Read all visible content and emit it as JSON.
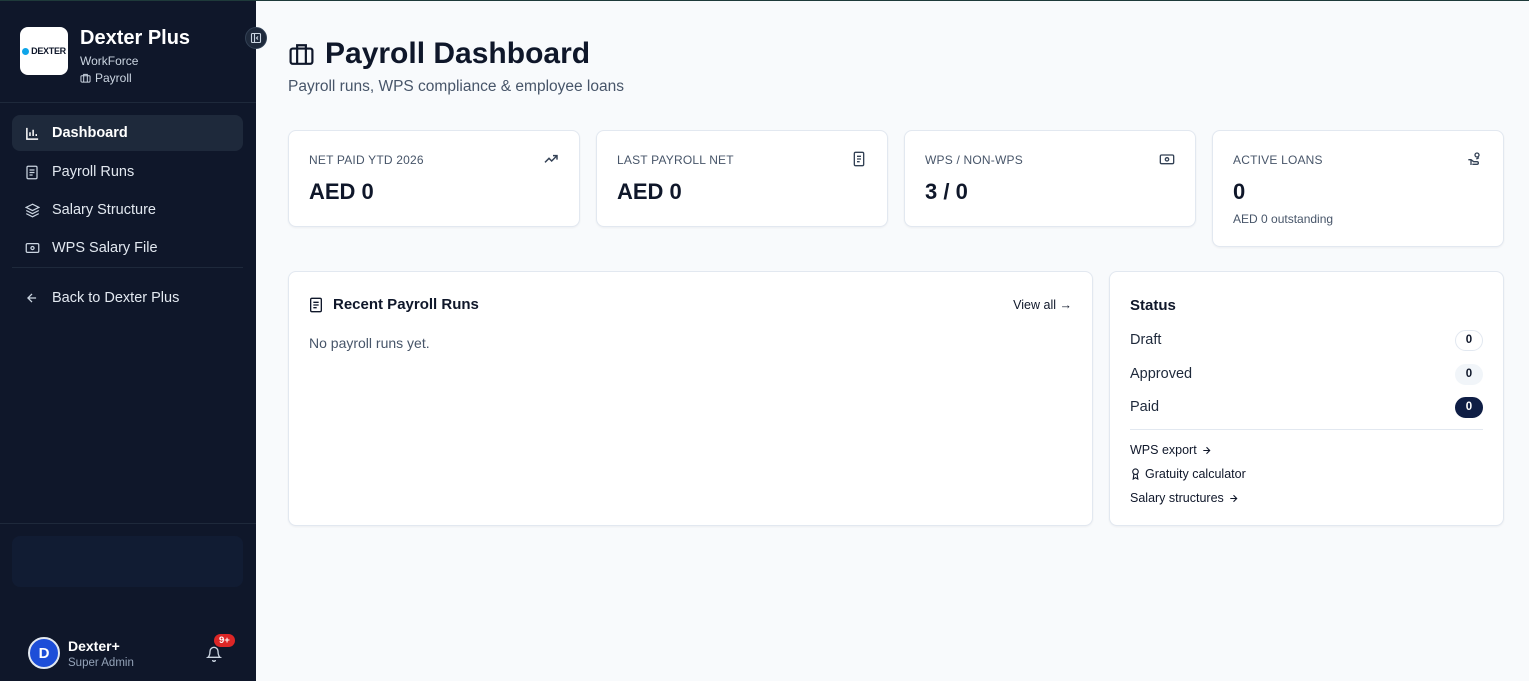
{
  "sidebar": {
    "brand_title": "Dexter Plus",
    "brand_sub": "WorkForce",
    "brand_module": "Payroll",
    "logo_text": "DEXTER",
    "nav": [
      {
        "label": "Dashboard",
        "icon": "bar-chart-icon",
        "active": true
      },
      {
        "label": "Payroll Runs",
        "icon": "document-icon"
      },
      {
        "label": "Salary Structure",
        "icon": "layers-icon"
      },
      {
        "label": "WPS Salary File",
        "icon": "banknote-icon"
      }
    ],
    "back_label": "Back to Dexter Plus",
    "user": {
      "initial": "D",
      "name": "Dexter+",
      "role": "Super Admin"
    },
    "notifications_badge": "9+"
  },
  "page": {
    "title": "Payroll Dashboard",
    "subtitle": "Payroll runs, WPS compliance & employee loans"
  },
  "kpis": [
    {
      "label": "NET PAID YTD 2026",
      "value": "AED 0",
      "icon": "trending-up-icon"
    },
    {
      "label": "LAST PAYROLL NET",
      "value": "AED 0",
      "icon": "document-icon"
    },
    {
      "label": "WPS / NON-WPS",
      "value": "3 / 0",
      "icon": "banknote-icon"
    },
    {
      "label": "ACTIVE LOANS",
      "value": "0",
      "note": "AED 0 outstanding",
      "icon": "hand-coins-icon"
    }
  ],
  "recent": {
    "title": "Recent Payroll Runs",
    "view_all": "View all →",
    "empty": "No payroll runs yet."
  },
  "status": {
    "title": "Status",
    "rows": [
      {
        "label": "Draft",
        "count": "0"
      },
      {
        "label": "Approved",
        "count": "0"
      },
      {
        "label": "Paid",
        "count": "0"
      }
    ],
    "links": {
      "wps_export": "WPS export",
      "gratuity": "Gratuity calculator",
      "salary_structures": "Salary structures"
    }
  },
  "colors": {
    "sidebar_bg": "#0f172a",
    "page_bg": "#f8fafc",
    "paid_pill": "#0f1e45",
    "badge": "#dc2626"
  }
}
